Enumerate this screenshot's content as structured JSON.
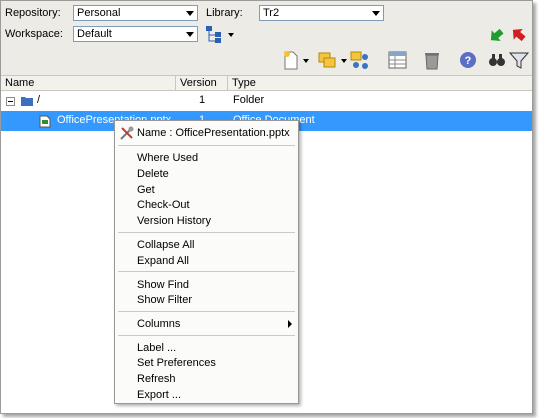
{
  "toolbar": {
    "repository_label": "Repository:",
    "repository_value": "Personal",
    "library_label": "Library:",
    "library_value": "Tr2",
    "workspace_label": "Workspace:",
    "workspace_value": "Default"
  },
  "columns": [
    "Name",
    "Version",
    "Type"
  ],
  "rows": [
    {
      "name": "/",
      "version": "1",
      "type": "Folder"
    },
    {
      "name": "OfficePresentation.pptx",
      "version": "1",
      "type": "Office Document"
    }
  ],
  "context_menu": {
    "header": "Name : OfficePresentation.pptx",
    "items": [
      "Where Used",
      "Delete",
      "Get",
      "Check-Out",
      "Version History",
      "Collapse All",
      "Expand All",
      "Show Find",
      "Show Filter",
      "Columns",
      "Label ...",
      "Set Preferences",
      "Refresh",
      "Export ..."
    ]
  },
  "colors": {
    "selection": "#3399ff",
    "toolbar_bg": "#ecebe5"
  },
  "icons": [
    "document-new-icon",
    "copy-icon",
    "share-icon",
    "table-icon",
    "trash-icon",
    "help-icon",
    "find-icon",
    "filter-icon",
    "checkin-icon",
    "checkout-icon",
    "hierarchy-icon",
    "tools-icon"
  ]
}
